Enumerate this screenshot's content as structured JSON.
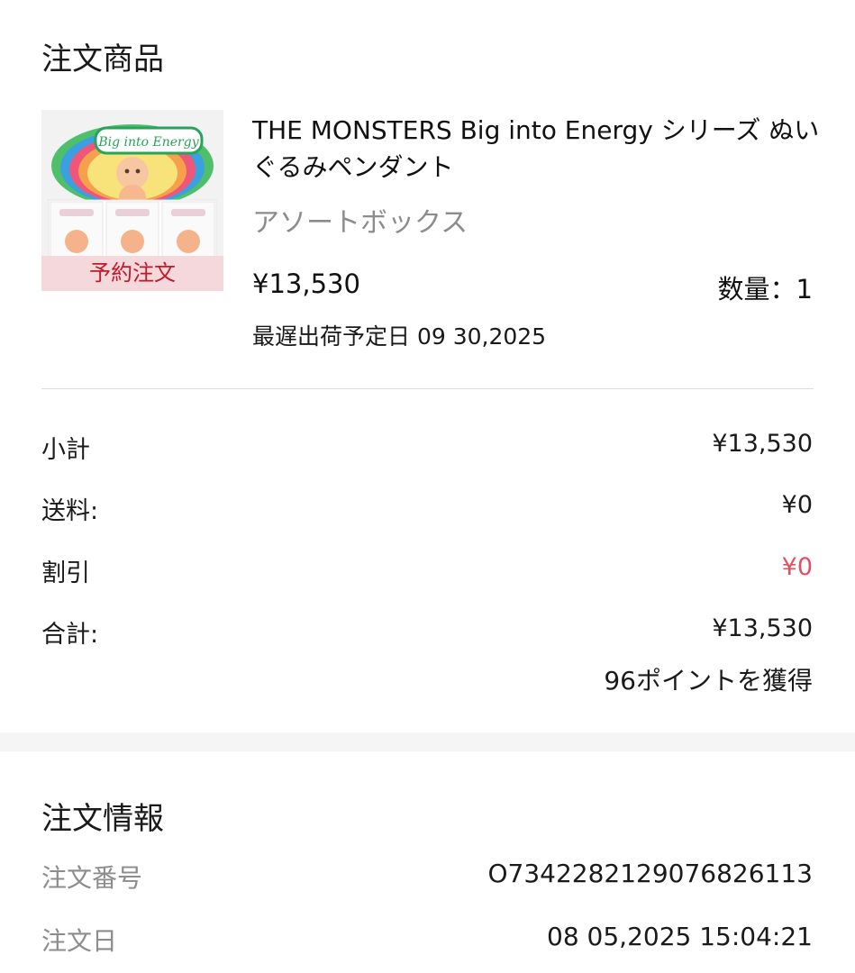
{
  "order_items": {
    "title": "注文商品",
    "product": {
      "name": "THE MONSTERS Big into Energy シリーズ ぬいぐるみペンダント",
      "variant": "アソートボックス",
      "price": "¥13,530",
      "quantity": "数量：1",
      "ship_date": "最遅出荷予定日 09 30,2025",
      "badge": "予約注文",
      "image_text": "Big into Energy"
    }
  },
  "summary": {
    "subtotal_label": "小計",
    "subtotal_value": "¥13,530",
    "shipping_label": "送料:",
    "shipping_value": "¥0",
    "discount_label": "割引",
    "discount_value": "¥0",
    "total_label": "合計:",
    "total_value": "¥13,530",
    "points": "96ポイントを獲得"
  },
  "order_info": {
    "title": "注文情報",
    "number_label": "注文番号",
    "number_value": "O734228212907682​6113",
    "date_label": "注文日",
    "date_value": "08 05,2025 15:04:21"
  },
  "colors": {
    "accent_red": "#e0505f",
    "badge_text": "#c4182b",
    "badge_bg": "#f5d7db",
    "muted_text": "#8c8c8c"
  }
}
